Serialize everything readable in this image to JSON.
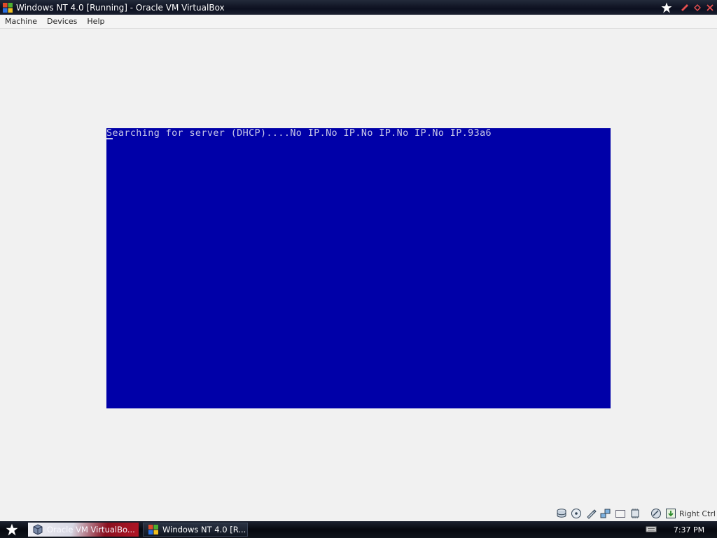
{
  "window": {
    "title": "Windows NT 4.0 [Running] - Oracle VM VirtualBox",
    "controls": [
      "minimize-icon",
      "restore-icon",
      "close-icon"
    ]
  },
  "menubar": {
    "items": [
      {
        "label": "Machine"
      },
      {
        "label": "Devices"
      },
      {
        "label": "Help"
      }
    ]
  },
  "vm": {
    "background": "#0000a8",
    "console_text": "Searching for server (DHCP)....No IP.No IP.No IP.No IP.No IP.93a6"
  },
  "statusbar": {
    "icons": [
      "hard-disk-icon",
      "optical-drive-icon",
      "usb-icon",
      "network-icon",
      "shared-folders-icon",
      "cpu-icon",
      "mouse-integration-icon",
      "keyboard-capture-icon"
    ],
    "host_key": "Right Ctrl"
  },
  "taskbar": {
    "tasks": [
      {
        "label": "Oracle VM VirtualBo..."
      },
      {
        "label": "Windows NT 4.0 [R..."
      }
    ],
    "clock": "7:37 PM"
  }
}
